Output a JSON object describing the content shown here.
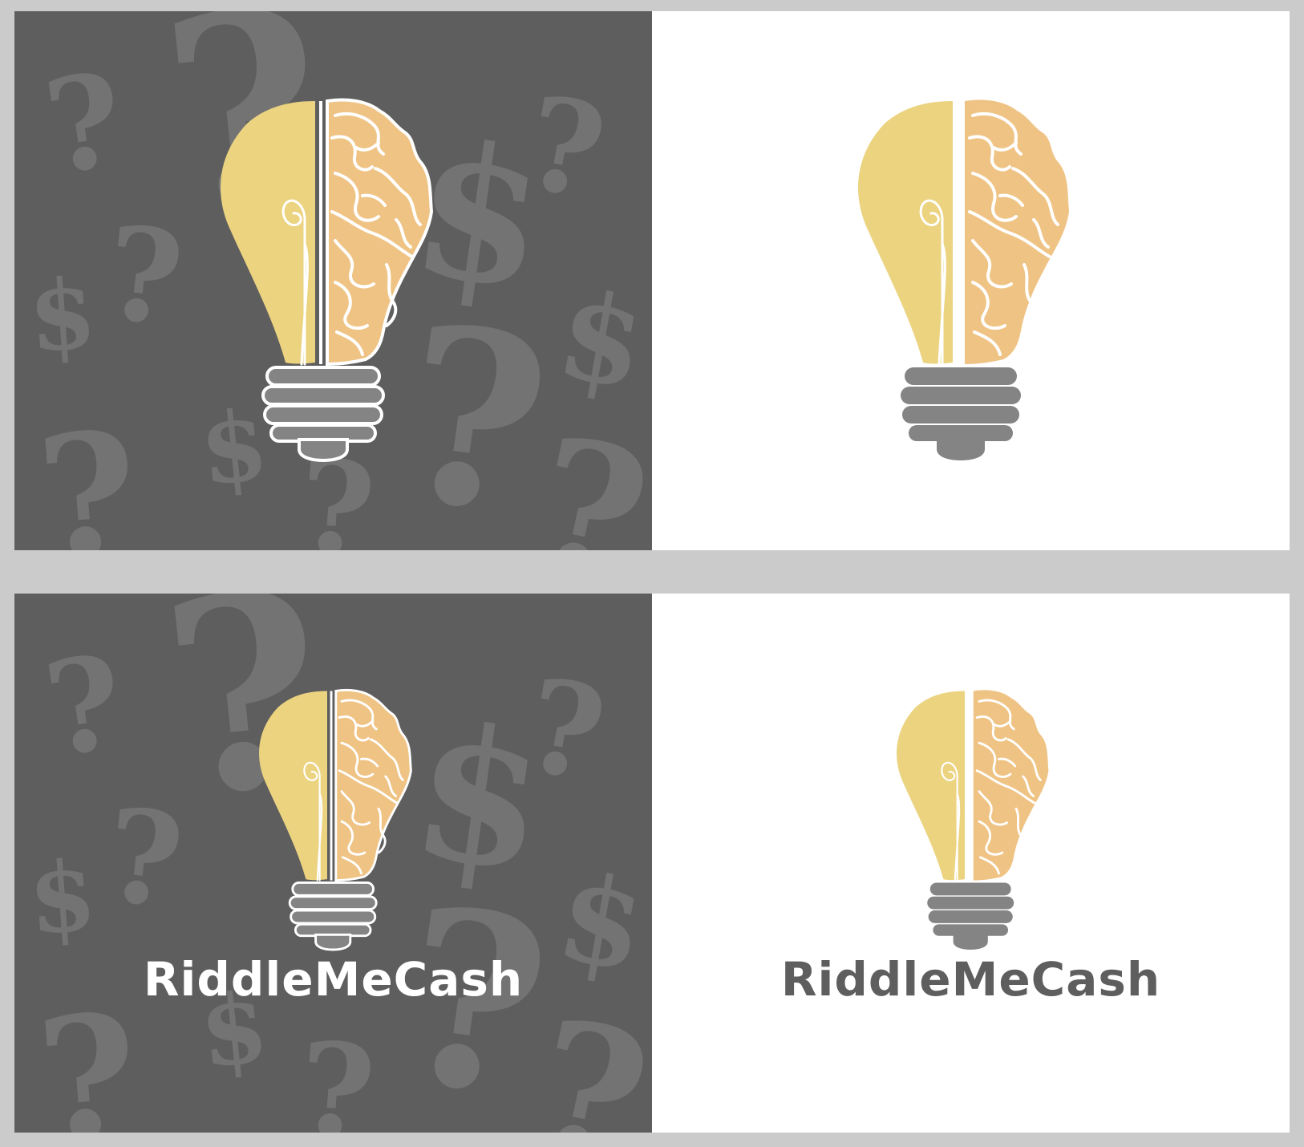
{
  "brand": {
    "name": "RiddleMeCash"
  },
  "colors": {
    "frame": "#cbcbcb",
    "dark_panel": "#5e5e5e",
    "light_panel": "#ffffff",
    "glyph_on_dark": "#737373",
    "bulb_yellow": "#ebd380",
    "brain_orange": "#efc384",
    "brain_line": "#ffffff",
    "base_grey": "#848484",
    "brand_on_dark": "#ffffff",
    "brand_on_light": "#5e5e5e"
  },
  "icons": {
    "logo": "lightbulb-brain-icon",
    "pattern_glyphs": [
      "question-mark-icon",
      "dollar-sign-icon"
    ]
  },
  "panels": [
    {
      "id": "dark-icon-only",
      "theme": "dark",
      "show_name": false
    },
    {
      "id": "light-icon-only",
      "theme": "light",
      "show_name": false
    },
    {
      "id": "dark-with-name",
      "theme": "dark",
      "show_name": true
    },
    {
      "id": "light-with-name",
      "theme": "light",
      "show_name": true
    }
  ],
  "pattern_glyph_chars": {
    "question": "?",
    "dollar": "$"
  }
}
